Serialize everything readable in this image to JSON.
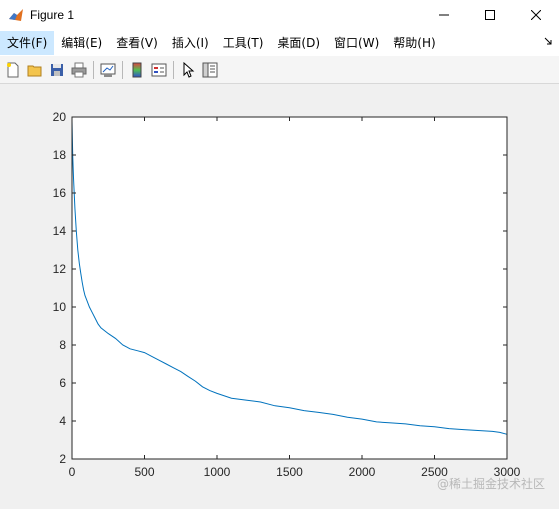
{
  "window": {
    "title": "Figure 1",
    "icon": "matlab-figure-icon"
  },
  "menu": {
    "items": [
      {
        "label": "文件(F)",
        "active": true
      },
      {
        "label": "编辑(E)"
      },
      {
        "label": "查看(V)"
      },
      {
        "label": "插入(I)"
      },
      {
        "label": "工具(T)"
      },
      {
        "label": "桌面(D)"
      },
      {
        "label": "窗口(W)"
      },
      {
        "label": "帮助(H)"
      }
    ]
  },
  "toolbar": {
    "buttons": [
      "new-figure-icon",
      "open-file-icon",
      "save-icon",
      "print-icon",
      "link-plot-icon",
      "insert-colorbar-icon",
      "insert-legend-icon",
      "edit-plot-icon",
      "property-inspector-icon"
    ]
  },
  "watermark": "@稀土掘金技术社区",
  "chart_data": {
    "type": "line",
    "title": "",
    "xlabel": "",
    "ylabel": "",
    "xlim": [
      0,
      3000
    ],
    "ylim": [
      2,
      20
    ],
    "xticks": [
      0,
      500,
      1000,
      1500,
      2000,
      2500,
      3000
    ],
    "yticks": [
      2,
      4,
      6,
      8,
      10,
      12,
      14,
      16,
      18,
      20
    ],
    "grid": false,
    "line_color": "#0072bd",
    "series": [
      {
        "x": [
          0,
          5,
          10,
          20,
          30,
          40,
          50,
          60,
          70,
          80,
          90,
          100,
          120,
          140,
          160,
          180,
          200,
          250,
          300,
          350,
          400,
          450,
          500,
          550,
          600,
          650,
          700,
          750,
          800,
          850,
          900,
          950,
          1000,
          1100,
          1200,
          1300,
          1400,
          1500,
          1600,
          1700,
          1800,
          1900,
          2000,
          2100,
          2200,
          2300,
          2400,
          2500,
          2600,
          2700,
          2800,
          2900,
          2950,
          3000
        ],
        "y": [
          19.8,
          18.0,
          16.8,
          15.2,
          14.0,
          13.0,
          12.3,
          11.8,
          11.3,
          10.9,
          10.6,
          10.4,
          10.0,
          9.7,
          9.4,
          9.1,
          8.9,
          8.6,
          8.35,
          8.0,
          7.8,
          7.7,
          7.6,
          7.4,
          7.2,
          7.0,
          6.8,
          6.6,
          6.35,
          6.1,
          5.8,
          5.6,
          5.45,
          5.2,
          5.1,
          5.0,
          4.8,
          4.7,
          4.55,
          4.45,
          4.35,
          4.2,
          4.1,
          3.95,
          3.9,
          3.85,
          3.75,
          3.7,
          3.6,
          3.55,
          3.5,
          3.45,
          3.4,
          3.3
        ]
      }
    ]
  }
}
